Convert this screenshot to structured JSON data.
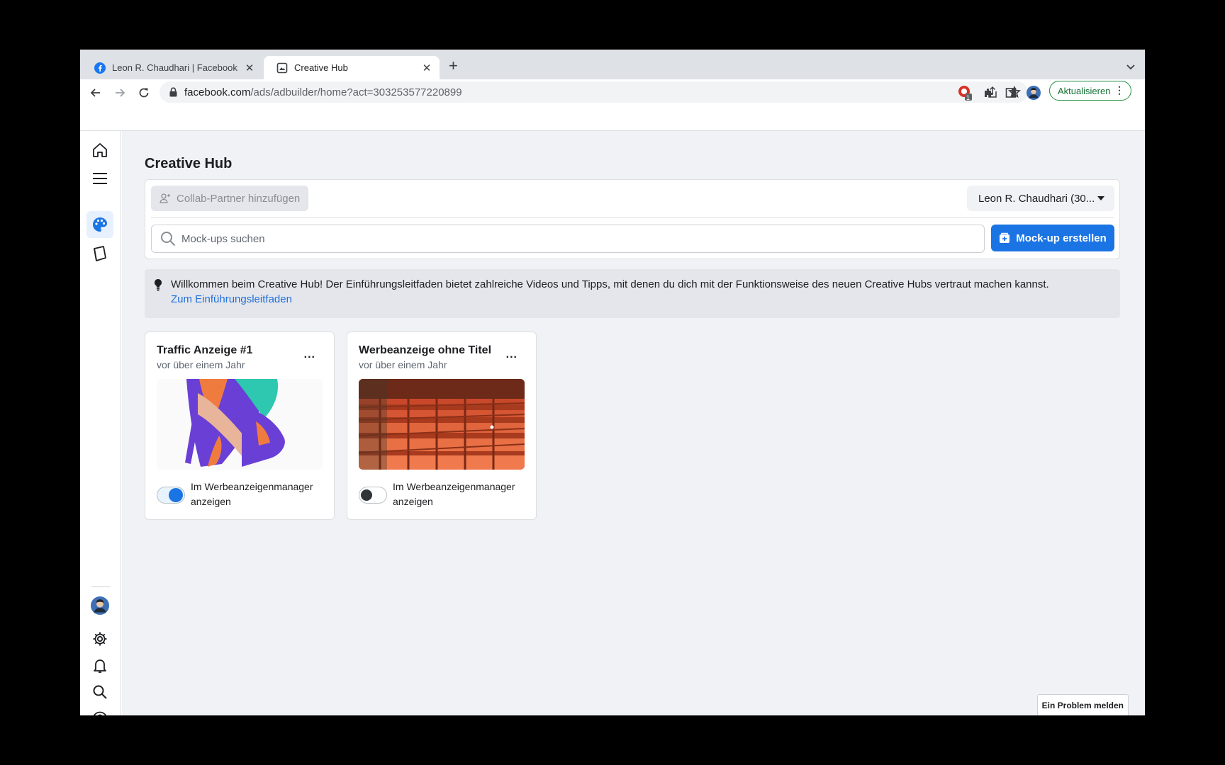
{
  "browser": {
    "tabs": [
      {
        "title": "Leon R. Chaudhari | Facebook",
        "close": "✕"
      },
      {
        "title": "Creative Hub",
        "close": "✕"
      }
    ],
    "new_tab": "+",
    "url_host": "facebook.com",
    "url_path": "/ads/adbuilder/home?act=303253577220899",
    "update_label": "Aktualisieren",
    "extension_badge": "1",
    "accent": "#1e8e3e"
  },
  "app": {
    "title": "Creative Hub",
    "collab_label": "Collab-Partner hinzufügen",
    "account_label": "Leon R. Chaudhari (30...",
    "search_placeholder": "Mock-ups suchen",
    "create_label": "Mock-up erstellen",
    "banner_text": "Willkommen beim Creative Hub! Der Einführungsleitfaden bietet zahlreiche Videos und Tipps, mit denen du dich mit der Funktionsweise des neuen Creative Hubs vertraut machen kannst.",
    "banner_link": "Zum Einführungsleitfaden",
    "report_label": "Ein Problem melden",
    "brand_color": "#1b74e4"
  },
  "mockups": [
    {
      "title": "Traffic Anzeige #1",
      "date": "vor über einem Jahr",
      "more": "...",
      "toggle_label": "Im Werbeanzeigenmanager anzeigen",
      "toggle_on": true
    },
    {
      "title": "Werbeanzeige ohne Titel",
      "date": "vor über einem Jahr",
      "more": "...",
      "toggle_label": "Im Werbeanzeigenmanager anzeigen",
      "toggle_on": false
    }
  ]
}
